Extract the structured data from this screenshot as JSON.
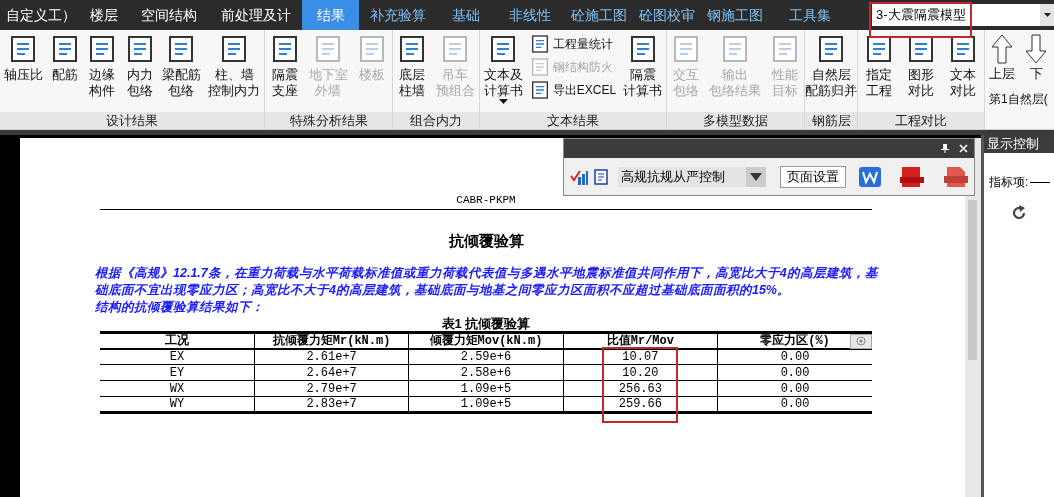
{
  "menu": [
    {
      "label": "自定义工）",
      "selected": false
    },
    {
      "label": "楼层",
      "selected": false
    },
    {
      "label": "空间结构",
      "selected": false
    },
    {
      "label": "前处理及计",
      "selected": false
    },
    {
      "label": "结果",
      "selected": true
    },
    {
      "label": "补充验算",
      "selected": false
    },
    {
      "label": "基础",
      "selected": false
    },
    {
      "label": "非线性",
      "selected": false
    },
    {
      "label": "砼施工图",
      "selected": false
    },
    {
      "label": "砼图校审",
      "selected": false
    },
    {
      "label": "钢施工图",
      "selected": false
    },
    {
      "label": "工具集",
      "selected": false
    }
  ],
  "model_selector": {
    "value": "3-大震隔震模型",
    "highlighted": true
  },
  "ribbon": [
    {
      "title": "设计结果",
      "items": [
        {
          "kind": "large",
          "lines": [
            "轴压比"
          ],
          "disabled": false
        },
        {
          "kind": "large",
          "lines": [
            "配筋"
          ],
          "disabled": false
        },
        {
          "kind": "large",
          "lines": [
            "边缘",
            "构件"
          ],
          "disabled": false
        },
        {
          "kind": "large",
          "lines": [
            "内力",
            "包络"
          ],
          "disabled": false
        },
        {
          "kind": "large",
          "lines": [
            "梁配筋",
            "包络"
          ],
          "disabled": false
        },
        {
          "kind": "large",
          "lines": [
            "柱、墙",
            "控制内力"
          ],
          "disabled": false
        }
      ]
    },
    {
      "title": "特殊分析结果",
      "items": [
        {
          "kind": "large",
          "lines": [
            "隔震",
            "支座"
          ],
          "disabled": false
        },
        {
          "kind": "large",
          "lines": [
            "地下室",
            "外墙"
          ],
          "disabled": true
        },
        {
          "kind": "large",
          "lines": [
            "楼板"
          ],
          "disabled": true
        }
      ]
    },
    {
      "title": "组合内力",
      "items": [
        {
          "kind": "large",
          "lines": [
            "底层",
            "柱墙"
          ],
          "disabled": false
        },
        {
          "kind": "large",
          "lines": [
            "吊车",
            "预组合"
          ],
          "disabled": true
        }
      ]
    },
    {
      "title": "文本结果",
      "items": [
        {
          "kind": "dropdown",
          "lines": [
            "文本及",
            "计算书"
          ],
          "disabled": false
        },
        {
          "kind": "small",
          "lines": [
            "工程量统计"
          ],
          "disabled": false
        },
        {
          "kind": "small",
          "lines": [
            "钢结构防火"
          ],
          "disabled": true
        },
        {
          "kind": "small",
          "lines": [
            "导出EXCEL"
          ],
          "disabled": false
        },
        {
          "kind": "large",
          "lines": [
            "隔震",
            "计算书"
          ],
          "disabled": false
        }
      ]
    },
    {
      "title": "多模型数据",
      "items": [
        {
          "kind": "large",
          "lines": [
            "交互",
            "包络"
          ],
          "disabled": true
        },
        {
          "kind": "large",
          "lines": [
            "输出",
            "包络结果"
          ],
          "disabled": true
        },
        {
          "kind": "large",
          "lines": [
            "性能",
            "目标"
          ],
          "disabled": true
        }
      ]
    },
    {
      "title": "钢筋层",
      "items": [
        {
          "kind": "large",
          "lines": [
            "自然层",
            "配筋归并"
          ],
          "disabled": false
        }
      ]
    },
    {
      "title": "工程对比",
      "items": [
        {
          "kind": "large",
          "lines": [
            "指定",
            "工程"
          ],
          "disabled": false
        },
        {
          "kind": "large",
          "lines": [
            "图形",
            "对比"
          ],
          "disabled": false
        },
        {
          "kind": "large",
          "lines": [
            "文本",
            "对比"
          ],
          "disabled": false
        }
      ]
    }
  ],
  "floor_nav": {
    "buttons": [
      "上层",
      "下"
    ],
    "floor_label": "第1自然层("
  },
  "float_toolbar": {
    "select": "高规抗规从严控制",
    "page_setup": "页面设置"
  },
  "document": {
    "header": "CABR-PKPM",
    "title": "抗倾覆验算",
    "paragraphs": [
      "根据《高规》12.1.7条，在重力荷载与水平荷载标准值或重力荷载代表值与多遇水平地震标准值共同作用下，高宽比大于4的高层建筑，基础底面不宜出现零应力区；高宽比不大于4的高层建筑，基础底面与地基之间零应力区面积不应超过基础底面面积的15%。",
      "结构的抗倾覆验算结果如下："
    ],
    "table": {
      "caption": "表1 抗倾覆验算",
      "columns": [
        {
          "label": "工况",
          "highlighted": false
        },
        {
          "label": "抗倾覆力矩Mr(kN.m)",
          "highlighted": false
        },
        {
          "label": "倾覆力矩Mov(kN.m)",
          "highlighted": false
        },
        {
          "label": "比值Mr/Mov",
          "highlighted": true
        },
        {
          "label": "零应力区(%)",
          "highlighted": false
        }
      ],
      "rows": [
        [
          "EX",
          "2.61e+7",
          "2.59e+6",
          "10.07",
          "0.00"
        ],
        [
          "EY",
          "2.64e+7",
          "2.58e+6",
          "10.20",
          "0.00"
        ],
        [
          "WX",
          "2.79e+7",
          "1.09e+5",
          "256.63",
          "0.00"
        ],
        [
          "WY",
          "2.83e+7",
          "1.09e+5",
          "259.66",
          "0.00"
        ]
      ]
    }
  },
  "side_panel": {
    "title": "显示控制",
    "field_label": "指标项:"
  }
}
